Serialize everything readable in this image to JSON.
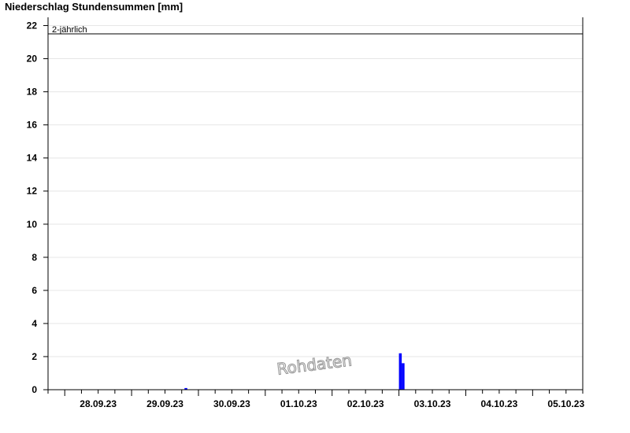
{
  "chart_data": {
    "type": "bar",
    "title": "Niederschlag Stundensummen [mm]",
    "xlabel": "",
    "ylabel": "",
    "ylim": [
      0,
      22.5
    ],
    "yticks": [
      0,
      2,
      4,
      6,
      8,
      10,
      12,
      14,
      16,
      18,
      20,
      22
    ],
    "grid": true,
    "date_labels": [
      "28.09.23",
      "29.09.23",
      "30.09.23",
      "01.10.23",
      "02.10.23",
      "03.10.23",
      "04.10.23",
      "05.10.23"
    ],
    "x_range": [
      "2023-09-27T18:00",
      "2023-10-05T18:00"
    ],
    "series": [
      {
        "color": "#0000ff",
        "points": [
          {
            "time": "2023-09-29T19:00",
            "value": 0.1
          },
          {
            "time": "2023-10-03T00:00",
            "value": 2.2
          },
          {
            "time": "2023-10-03T01:00",
            "value": 1.6
          }
        ]
      }
    ],
    "reference_line": {
      "label": "2-jährlich",
      "value": 21.5,
      "color": "#000000"
    },
    "watermark": "Rohdaten",
    "axis_color": "#000000",
    "grid_color": "#e6e6e6"
  }
}
